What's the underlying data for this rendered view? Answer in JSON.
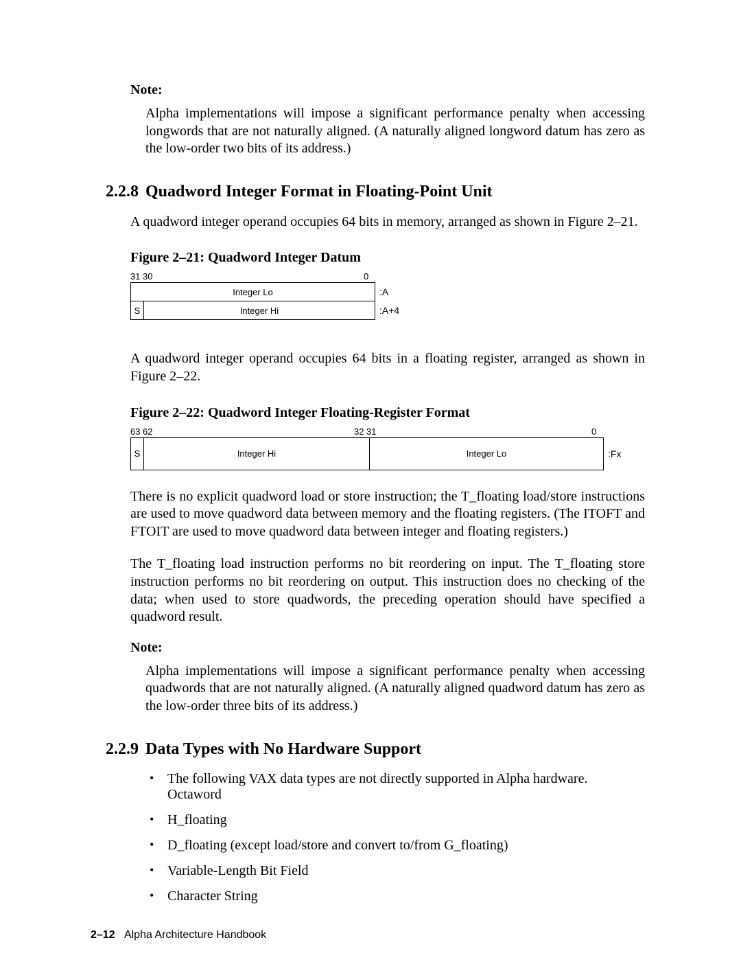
{
  "note1": {
    "heading": "Note:",
    "body": "Alpha implementations will impose a significant performance penalty when accessing longwords that are not naturally aligned. (A naturally aligned longword datum has zero as the low-order two bits of its address.)"
  },
  "section228": {
    "number": "2.2.8",
    "title": "Quadword Integer Format in Floating-Point Unit",
    "intro": "A quadword integer operand occupies 64 bits in memory, arranged as shown in Figure 2–21."
  },
  "figure21": {
    "caption": "Figure 2–21:  Quadword Integer Datum",
    "bits": {
      "left": "31",
      "left2": "30",
      "right": "0"
    },
    "row1": {
      "label": "Integer Lo",
      "addr": ":A"
    },
    "row2": {
      "s": "S",
      "label": "Integer Hi",
      "addr": ":A+4"
    }
  },
  "para_after_fig21": "A quadword integer operand occupies 64 bits in a floating register, arranged as shown in Figure 2–22.",
  "figure22": {
    "caption": "Figure 2–22:  Quadword Integer Floating-Register Format",
    "bits": {
      "b63": "63",
      "b62": "62",
      "b32": "32",
      "b31": "31",
      "b0": "0"
    },
    "row": {
      "s": "S",
      "hi": "Integer Hi",
      "lo": "Integer Lo",
      "side": ":Fx"
    }
  },
  "para_after_fig22a": "There is no explicit quadword load or store instruction; the T_floating load/store instructions are used to move quadword data between memory and the floating registers. (The ITOFT and FTOIT are used to move quadword data between integer and floating registers.)",
  "para_after_fig22b": "The T_floating load instruction performs no bit reordering on input. The T_floating store instruction performs no bit reordering on output. This instruction does no checking of the data; when used to store quadwords, the preceding operation should have specified a quadword result.",
  "note2": {
    "heading": "Note:",
    "body": "Alpha implementations will impose a significant performance penalty when accessing quadwords that are not naturally aligned. (A naturally aligned quadword datum has zero as the low-order three bits of its address.)"
  },
  "section229": {
    "number": "2.2.9",
    "title": "Data Types with No Hardware Support",
    "bullets": [
      "The following VAX data types are not directly supported in Alpha hardware. Octaword",
      "H_floating",
      "D_floating (except load/store and convert to/from G_floating)",
      "Variable-Length Bit Field",
      "Character String"
    ]
  },
  "footer": {
    "pagenum": "2–12",
    "title": "Alpha Architecture Handbook"
  }
}
